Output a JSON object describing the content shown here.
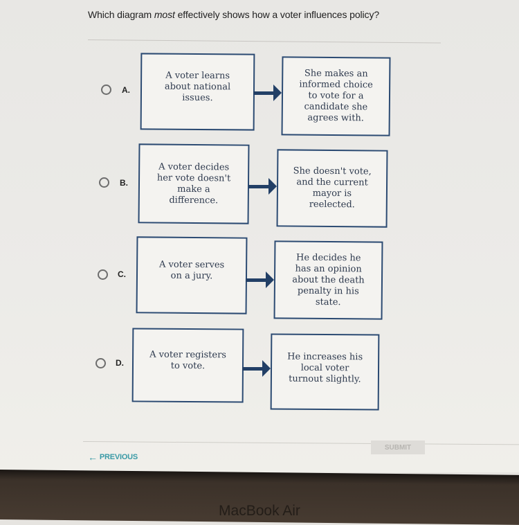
{
  "question": {
    "prefix": "Which diagram ",
    "emphasis": "most",
    "suffix": " effectively shows how a voter influences policy?"
  },
  "options": [
    {
      "letter": "A.",
      "cause": "A voter learns\nabout national\nissues.",
      "effect": "She makes an\ninformed choice\nto vote for a\ncandidate she\nagrees with.",
      "selected": false
    },
    {
      "letter": "B.",
      "cause": "A voter decides\nher vote doesn't\nmake a\ndifference.",
      "effect": "She doesn't vote,\nand the current\nmayor is\nreelected.",
      "selected": false
    },
    {
      "letter": "C.",
      "cause": "A voter serves\non a jury.",
      "effect": "He decides he\nhas an opinion\nabout the death\npenalty in his\nstate.",
      "selected": false
    },
    {
      "letter": "D.",
      "cause": "A voter registers\nto vote.",
      "effect": "He increases his\nlocal voter\nturnout slightly.",
      "selected": false
    }
  ],
  "footer": {
    "previous_icon": "arrow-left-icon",
    "previous_label": "PREVIOUS",
    "submit_label": "SUBMIT",
    "submit_enabled": false
  },
  "device": {
    "label": "MacBook Air"
  },
  "colors": {
    "box_border": "#2b4a72",
    "arrow": "#223f66",
    "previous_link": "#3a9aa6",
    "submit_disabled_bg": "#dedcd8"
  }
}
